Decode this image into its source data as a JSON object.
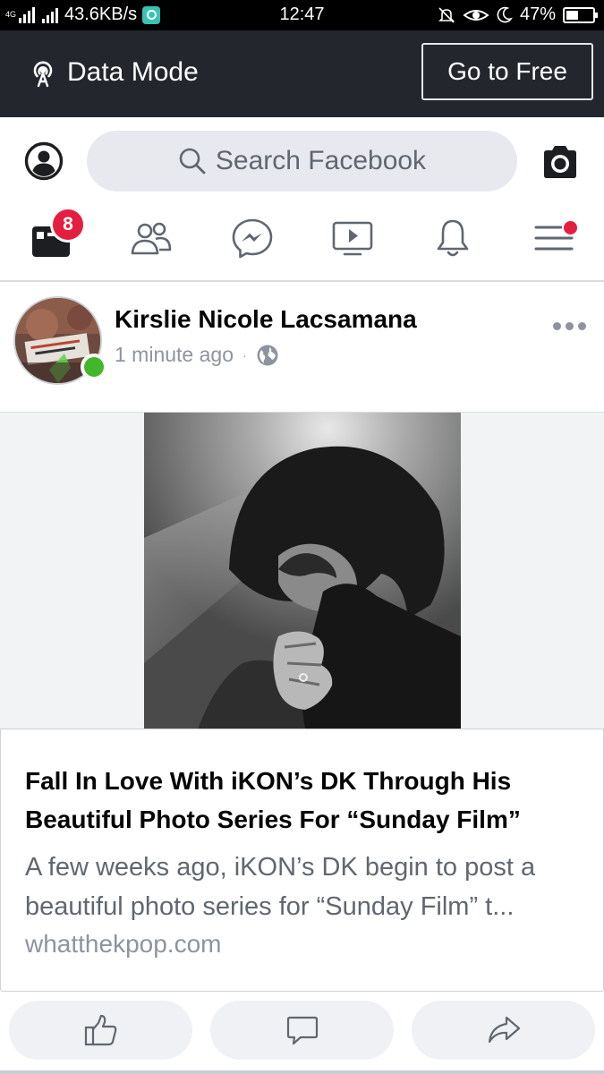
{
  "status_bar": {
    "network": "4G",
    "speed": "43.6KB/s",
    "time": "12:47",
    "battery": "47%",
    "battery_level": 0.47
  },
  "data_mode": {
    "label": "Data Mode",
    "go_free_label": "Go to Free"
  },
  "header": {
    "search_placeholder": "Search Facebook",
    "news_feed_badge": "8"
  },
  "post": {
    "author": "Kirslie Nicole Lacsamana",
    "timestamp": "1 minute ago",
    "separator": "·",
    "author_online": true,
    "link": {
      "title": "Fall In Love With iKON’s DK Through His Beautiful Photo Series For “Sunday Film”",
      "description": "A few weeks ago, iKON’s DK begin to post a beautiful photo series for “Sunday Film” t...",
      "domain": "whatthekpop.com"
    }
  },
  "icons": {
    "nav": [
      "news-feed-icon",
      "friends-icon",
      "messenger-icon",
      "watch-icon",
      "notifications-icon",
      "menu-icon"
    ],
    "actions": [
      "like-icon",
      "comment-icon",
      "share-icon"
    ]
  },
  "colors": {
    "data_bar_bg": "#23272d",
    "badge_red": "#e41e3f",
    "online_green": "#42b72a",
    "search_bg": "#e8e9ee"
  }
}
